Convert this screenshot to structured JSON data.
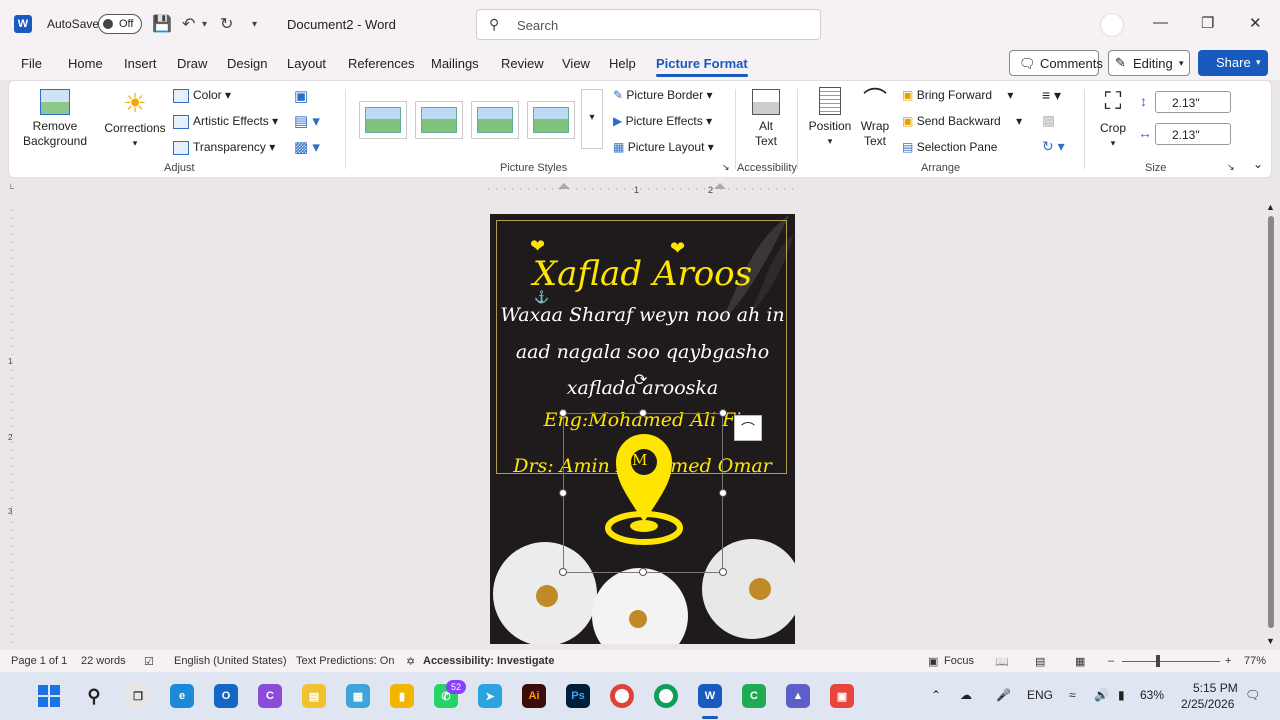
{
  "titlebar": {
    "autosave_label": "AutoSave",
    "autosave_state": "Off",
    "doc_title": "Document2  -  Word",
    "search_placeholder": "Search"
  },
  "menu": {
    "tabs": [
      "File",
      "Home",
      "Insert",
      "Draw",
      "Design",
      "Layout",
      "References",
      "Mailings",
      "Review",
      "View",
      "Help",
      "Picture Format"
    ],
    "active_tab": "Picture Format",
    "comments": "Comments",
    "editing": "Editing",
    "share": "Share"
  },
  "ribbon": {
    "adjust": {
      "remove_bg": [
        "Remove",
        "Background"
      ],
      "corrections": "Corrections",
      "color": "Color",
      "artistic": "Artistic Effects",
      "transparency": "Transparency",
      "label": "Adjust"
    },
    "styles": {
      "border": "Picture Border",
      "effects": "Picture Effects",
      "layout": "Picture Layout",
      "label": "Picture Styles"
    },
    "accessibility": {
      "alt_text": [
        "Alt",
        "Text"
      ],
      "label": "Accessibility"
    },
    "arrange": {
      "position": "Position",
      "wrap": [
        "Wrap",
        "Text"
      ],
      "bring_forward": "Bring Forward",
      "send_backward": "Send Backward",
      "selection_pane": "Selection Pane",
      "label": "Arrange"
    },
    "size": {
      "crop": "Crop",
      "height": "2.13\"",
      "width": "2.13\"",
      "label": "Size"
    }
  },
  "document": {
    "title": "Xaflad Aroos",
    "line1": "Waxaa Sharaf weyn noo ah in",
    "line2": "aad nagala soo qaybgasho",
    "line3": "xaflada arooska",
    "name1": "Eng:Mohamed Ali Fi",
    "name2": "Drs: Amin  Mohamed Omar",
    "pin_letter": "M"
  },
  "status": {
    "page": "Page 1 of 1",
    "words": "22 words",
    "language": "English (United States)",
    "predictions": "Text Predictions: On",
    "accessibility": "Accessibility: Investigate",
    "focus": "Focus",
    "zoom": "77%"
  },
  "taskbar": {
    "whatsapp_badge": "52",
    "lang": "ENG",
    "battery": "63%",
    "time": "5:15 PM",
    "date": "2/25/2026"
  }
}
